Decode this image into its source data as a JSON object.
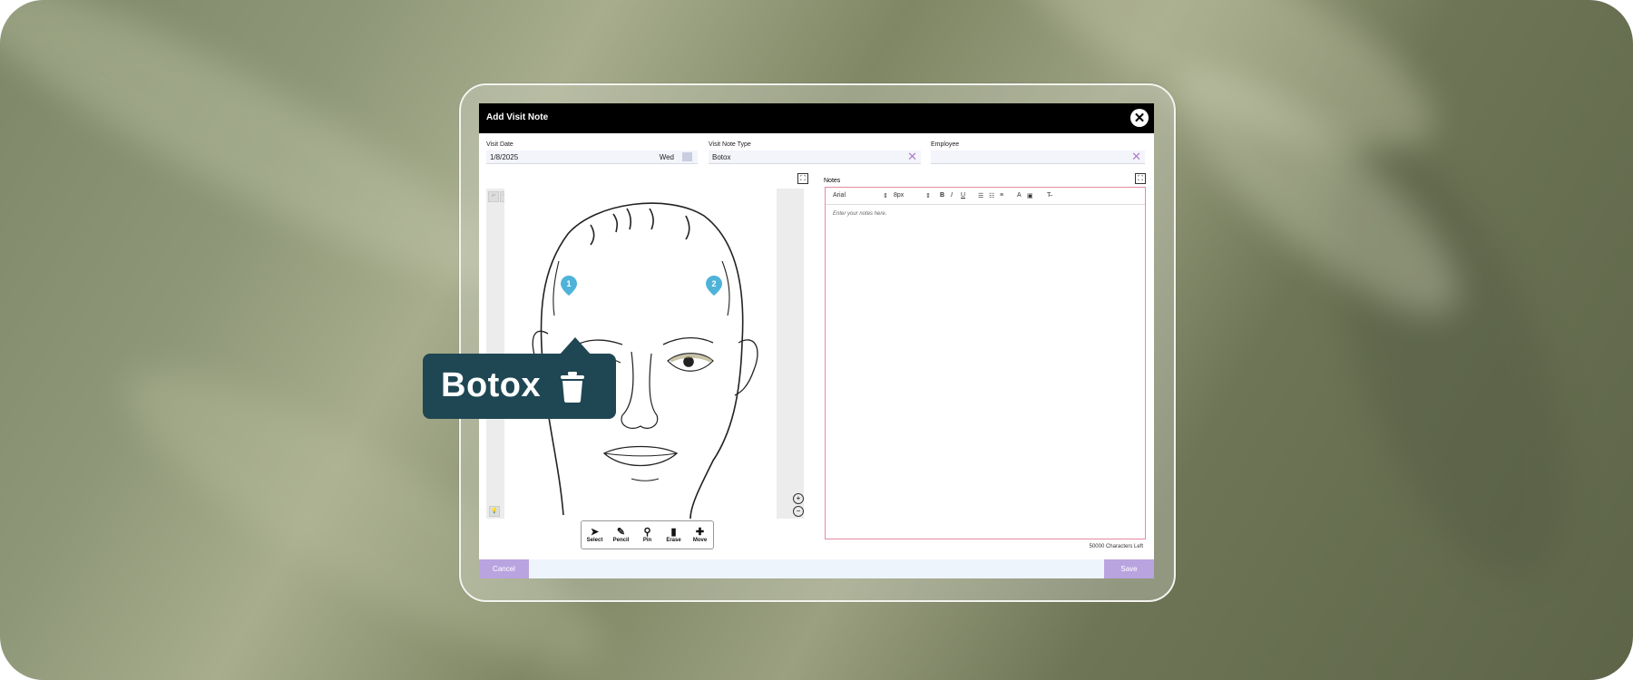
{
  "modal": {
    "title": "Add Visit Note"
  },
  "fields": {
    "visit_date_label": "Visit Date",
    "visit_date_value": "1/8/2025",
    "visit_date_day": "Wed",
    "visit_note_type_label": "Visit Note Type",
    "visit_note_type_value": "Botox",
    "employee_label": "Employee",
    "employee_value": ""
  },
  "canvas": {
    "pins": [
      "1",
      "2"
    ],
    "tools": [
      {
        "label": "Select",
        "icon": "cursor-icon"
      },
      {
        "label": "Pencil",
        "icon": "pencil-icon"
      },
      {
        "label": "Pin",
        "icon": "pin-icon"
      },
      {
        "label": "Erase",
        "icon": "eraser-icon"
      },
      {
        "label": "Move",
        "icon": "move-icon"
      }
    ]
  },
  "notes": {
    "label": "Notes",
    "font": "Arial",
    "size": "8px",
    "placeholder": "Enter your notes here.",
    "chars_left": "50000 Characters Left"
  },
  "footer": {
    "cancel": "Cancel",
    "save": "Save"
  },
  "callout": {
    "text": "Botox"
  },
  "colors": {
    "header": "#000000",
    "accent": "#b9a4e0",
    "pin": "#4fb3d9",
    "callout": "#1f4753",
    "notes_border": "#e58aa0"
  }
}
